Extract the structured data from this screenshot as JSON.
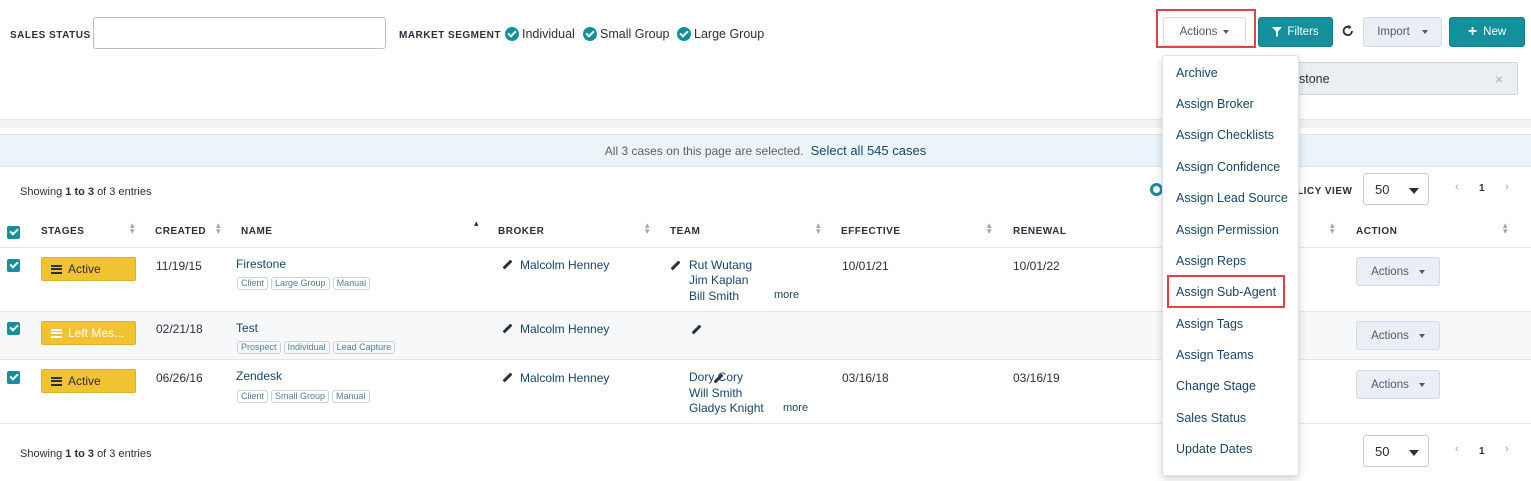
{
  "filters": {
    "sales_status_label": "SALES STATUS",
    "sales_status_value": "",
    "market_segment_label": "MARKET SEGMENT",
    "segments": [
      {
        "label": "Individual",
        "checked": true
      },
      {
        "label": "Small Group",
        "checked": true
      },
      {
        "label": "Large Group",
        "checked": true
      }
    ],
    "search_chip_text": "stone"
  },
  "toolbar": {
    "actions_label": "Actions",
    "filters_label": "Filters",
    "import_label": "Import",
    "new_label": "New"
  },
  "selection_banner": {
    "message": "All 3 cases on this page are selected.",
    "select_all_link": "Select all 545 cases"
  },
  "table": {
    "showing_prefix": "Showing",
    "showing_range": "1 to 3",
    "showing_suffix": "of 3 entries",
    "policy_view_label": "LICY VIEW",
    "page_size": "50",
    "page_number": "1",
    "headers": {
      "stages": "STAGES",
      "created": "CREATED",
      "name": "NAME",
      "broker": "BROKER",
      "team": "TEAM",
      "effective": "EFFECTIVE",
      "renewal": "RENEWAL",
      "action": "ACTION"
    },
    "rows": [
      {
        "stage": "Active",
        "created": "11/19/15",
        "name": "Firestone",
        "tags": [
          "Client",
          "Large Group",
          "Manual"
        ],
        "broker": "Malcolm Henney",
        "team": [
          "Rut Wutang",
          "Jim Kaplan",
          "Bill Smith"
        ],
        "team_more": "more",
        "effective": "10/01/21",
        "renewal": "10/01/22",
        "action": "Actions"
      },
      {
        "stage": "Left Mes...",
        "created": "02/21/18",
        "name": "Test",
        "tags": [
          "Prospect",
          "Individual",
          "Lead Capture"
        ],
        "broker": "Malcolm Henney",
        "team": [],
        "team_more": "",
        "effective": "",
        "renewal": "",
        "action": "Actions"
      },
      {
        "stage": "Active",
        "created": "06/26/16",
        "name": "Zendesk",
        "tags": [
          "Client",
          "Small Group",
          "Manual"
        ],
        "broker": "Malcolm Henney",
        "team": [
          "Dory Cory",
          "Will Smith",
          "Gladys Knight"
        ],
        "team_more": "more",
        "effective": "03/16/18",
        "renewal": "03/16/19",
        "action": "Actions"
      }
    ]
  },
  "actions_menu": {
    "items": [
      "Archive",
      "Assign Broker",
      "Assign Checklists",
      "Assign Confidence",
      "Assign Lead Source",
      "Assign Permission",
      "Assign Reps",
      "Assign Sub-Agent",
      "Assign Tags",
      "Assign Teams",
      "Change Stage",
      "Sales Status",
      "Update Dates"
    ],
    "highlighted_item": "Assign Sub-Agent"
  },
  "colors": {
    "accent": "#148f9c",
    "stage_yellow": "#f1c232",
    "link": "#1a4469",
    "highlight_red": "#e04346",
    "banner_bg": "#eaf4fa"
  }
}
